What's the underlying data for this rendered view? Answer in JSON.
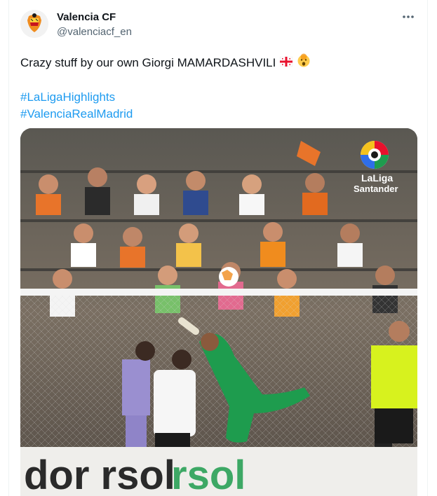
{
  "tweet": {
    "author_name": "Valencia CF",
    "author_handle": "@valenciacf_en",
    "text": "Crazy stuff by our own Giorgi MAMARDASHVILI",
    "emojis": [
      "georgia-flag",
      "shocked-face"
    ],
    "hashtags": [
      "#LaLigaHighlights",
      "#ValenciaRealMadrid"
    ]
  },
  "media": {
    "logo_line1": "LaLiga",
    "logo_line2": "Santander",
    "board_text": "dor  rsol"
  },
  "colors": {
    "accent": "#1d9bf0",
    "text": "#0f1419",
    "muted": "#536471",
    "keeper_green": "#1e9c4e",
    "referee_yellow": "#d7f21e"
  }
}
